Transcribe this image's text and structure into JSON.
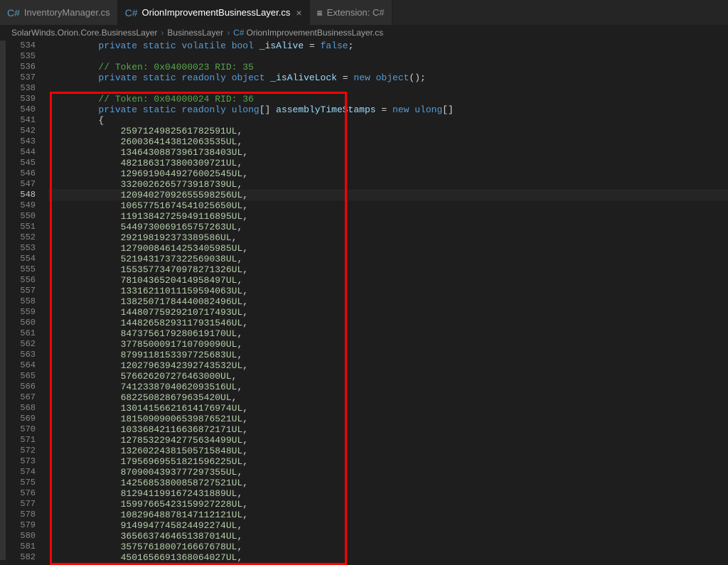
{
  "tabs": [
    {
      "label": "InventoryManager.cs",
      "iconGlyph": "C#",
      "active": false
    },
    {
      "label": "OrionImprovementBusinessLayer.cs",
      "iconGlyph": "C#",
      "active": true
    },
    {
      "label": "Extension: C#",
      "iconGlyph": "≡",
      "active": false,
      "ext": true
    }
  ],
  "breadcrumb": {
    "items": [
      "SolarWinds.Orion.Core.BusinessLayer",
      "BusinessLayer",
      "OrionImprovementBusinessLayer.cs"
    ]
  },
  "editor": {
    "firstLine": 534,
    "lastLine": 582,
    "currentLine": 548,
    "highlightStart": 539,
    "highlightEnd": 582,
    "indentUnit": "    ",
    "lines": {
      "534": {
        "indent": 2,
        "tokens": [
          [
            "kw",
            "private"
          ],
          [
            "sp",
            " "
          ],
          [
            "kw",
            "static"
          ],
          [
            "sp",
            " "
          ],
          [
            "kw",
            "volatile"
          ],
          [
            "sp",
            " "
          ],
          [
            "type",
            "bool"
          ],
          [
            "sp",
            " "
          ],
          [
            "ident",
            "_isAlive"
          ],
          [
            "sp",
            " "
          ],
          [
            "op",
            "="
          ],
          [
            "sp",
            " "
          ],
          [
            "kw",
            "false"
          ],
          [
            "punc",
            ";"
          ]
        ]
      },
      "535": {
        "indent": 0,
        "tokens": []
      },
      "536": {
        "indent": 2,
        "tokens": [
          [
            "comment",
            "// Token: 0x04000023 RID: 35"
          ]
        ]
      },
      "537": {
        "indent": 2,
        "tokens": [
          [
            "kw",
            "private"
          ],
          [
            "sp",
            " "
          ],
          [
            "kw",
            "static"
          ],
          [
            "sp",
            " "
          ],
          [
            "kw",
            "readonly"
          ],
          [
            "sp",
            " "
          ],
          [
            "type",
            "object"
          ],
          [
            "sp",
            " "
          ],
          [
            "ident",
            "_isAliveLock"
          ],
          [
            "sp",
            " "
          ],
          [
            "op",
            "="
          ],
          [
            "sp",
            " "
          ],
          [
            "kw",
            "new"
          ],
          [
            "sp",
            " "
          ],
          [
            "type",
            "object"
          ],
          [
            "punc",
            "();"
          ]
        ]
      },
      "538": {
        "indent": 0,
        "tokens": []
      },
      "539": {
        "indent": 2,
        "tokens": [
          [
            "comment",
            "// Token: 0x04000024 RID: 36"
          ]
        ]
      },
      "540": {
        "indent": 2,
        "tokens": [
          [
            "kw",
            "private"
          ],
          [
            "sp",
            " "
          ],
          [
            "kw",
            "static"
          ],
          [
            "sp",
            " "
          ],
          [
            "kw",
            "readonly"
          ],
          [
            "sp",
            " "
          ],
          [
            "type",
            "ulong"
          ],
          [
            "punc",
            "[]"
          ],
          [
            "sp",
            " "
          ],
          [
            "ident",
            "assemblyTimeStamps"
          ],
          [
            "sp",
            " "
          ],
          [
            "op",
            "="
          ],
          [
            "sp",
            " "
          ],
          [
            "kw",
            "new"
          ],
          [
            "sp",
            " "
          ],
          [
            "type",
            "ulong"
          ],
          [
            "punc",
            "[]"
          ]
        ]
      },
      "541": {
        "indent": 2,
        "tokens": [
          [
            "punc",
            "{"
          ]
        ]
      },
      "542": {
        "indent": 3,
        "tokens": [
          [
            "num",
            "2597124982561782591UL"
          ],
          [
            "punc",
            ","
          ]
        ]
      },
      "543": {
        "indent": 3,
        "tokens": [
          [
            "num",
            "2600364143812063535UL"
          ],
          [
            "punc",
            ","
          ]
        ]
      },
      "544": {
        "indent": 3,
        "tokens": [
          [
            "num",
            "13464308873961738403UL"
          ],
          [
            "punc",
            ","
          ]
        ]
      },
      "545": {
        "indent": 3,
        "tokens": [
          [
            "num",
            "4821863173800309721UL"
          ],
          [
            "punc",
            ","
          ]
        ]
      },
      "546": {
        "indent": 3,
        "tokens": [
          [
            "num",
            "12969190449276002545UL"
          ],
          [
            "punc",
            ","
          ]
        ]
      },
      "547": {
        "indent": 3,
        "tokens": [
          [
            "num",
            "3320026265773918739UL"
          ],
          [
            "punc",
            ","
          ]
        ]
      },
      "548": {
        "indent": 3,
        "tokens": [
          [
            "num",
            "12094027092655598256UL"
          ],
          [
            "punc",
            ","
          ]
        ]
      },
      "549": {
        "indent": 3,
        "tokens": [
          [
            "num",
            "10657751674541025650UL"
          ],
          [
            "punc",
            ","
          ]
        ]
      },
      "550": {
        "indent": 3,
        "tokens": [
          [
            "num",
            "11913842725949116895UL"
          ],
          [
            "punc",
            ","
          ]
        ]
      },
      "551": {
        "indent": 3,
        "tokens": [
          [
            "num",
            "5449730069165757263UL"
          ],
          [
            "punc",
            ","
          ]
        ]
      },
      "552": {
        "indent": 3,
        "tokens": [
          [
            "num",
            "292198192373389586UL"
          ],
          [
            "punc",
            ","
          ]
        ]
      },
      "553": {
        "indent": 3,
        "tokens": [
          [
            "num",
            "12790084614253405985UL"
          ],
          [
            "punc",
            ","
          ]
        ]
      },
      "554": {
        "indent": 3,
        "tokens": [
          [
            "num",
            "5219431737322569038UL"
          ],
          [
            "punc",
            ","
          ]
        ]
      },
      "555": {
        "indent": 3,
        "tokens": [
          [
            "num",
            "15535773470978271326UL"
          ],
          [
            "punc",
            ","
          ]
        ]
      },
      "556": {
        "indent": 3,
        "tokens": [
          [
            "num",
            "7810436520414958497UL"
          ],
          [
            "punc",
            ","
          ]
        ]
      },
      "557": {
        "indent": 3,
        "tokens": [
          [
            "num",
            "13316211011159594063UL"
          ],
          [
            "punc",
            ","
          ]
        ]
      },
      "558": {
        "indent": 3,
        "tokens": [
          [
            "num",
            "13825071784440082496UL"
          ],
          [
            "punc",
            ","
          ]
        ]
      },
      "559": {
        "indent": 3,
        "tokens": [
          [
            "num",
            "14480775929210717493UL"
          ],
          [
            "punc",
            ","
          ]
        ]
      },
      "560": {
        "indent": 3,
        "tokens": [
          [
            "num",
            "14482658293117931546UL"
          ],
          [
            "punc",
            ","
          ]
        ]
      },
      "561": {
        "indent": 3,
        "tokens": [
          [
            "num",
            "8473756179280619170UL"
          ],
          [
            "punc",
            ","
          ]
        ]
      },
      "562": {
        "indent": 3,
        "tokens": [
          [
            "num",
            "3778500091710709090UL"
          ],
          [
            "punc",
            ","
          ]
        ]
      },
      "563": {
        "indent": 3,
        "tokens": [
          [
            "num",
            "8799118153397725683UL"
          ],
          [
            "punc",
            ","
          ]
        ]
      },
      "564": {
        "indent": 3,
        "tokens": [
          [
            "num",
            "12027963942392743532UL"
          ],
          [
            "punc",
            ","
          ]
        ]
      },
      "565": {
        "indent": 3,
        "tokens": [
          [
            "num",
            "576626207276463000UL"
          ],
          [
            "punc",
            ","
          ]
        ]
      },
      "566": {
        "indent": 3,
        "tokens": [
          [
            "num",
            "7412338704062093516UL"
          ],
          [
            "punc",
            ","
          ]
        ]
      },
      "567": {
        "indent": 3,
        "tokens": [
          [
            "num",
            "682250828679635420UL"
          ],
          [
            "punc",
            ","
          ]
        ]
      },
      "568": {
        "indent": 3,
        "tokens": [
          [
            "num",
            "13014156621614176974UL"
          ],
          [
            "punc",
            ","
          ]
        ]
      },
      "569": {
        "indent": 3,
        "tokens": [
          [
            "num",
            "18150909006539876521UL"
          ],
          [
            "punc",
            ","
          ]
        ]
      },
      "570": {
        "indent": 3,
        "tokens": [
          [
            "num",
            "10336842116636872171UL"
          ],
          [
            "punc",
            ","
          ]
        ]
      },
      "571": {
        "indent": 3,
        "tokens": [
          [
            "num",
            "12785322942775634499UL"
          ],
          [
            "punc",
            ","
          ]
        ]
      },
      "572": {
        "indent": 3,
        "tokens": [
          [
            "num",
            "13260224381505715848UL"
          ],
          [
            "punc",
            ","
          ]
        ]
      },
      "573": {
        "indent": 3,
        "tokens": [
          [
            "num",
            "17956969551821596225UL"
          ],
          [
            "punc",
            ","
          ]
        ]
      },
      "574": {
        "indent": 3,
        "tokens": [
          [
            "num",
            "8709004393777297355UL"
          ],
          [
            "punc",
            ","
          ]
        ]
      },
      "575": {
        "indent": 3,
        "tokens": [
          [
            "num",
            "14256853800858727521UL"
          ],
          [
            "punc",
            ","
          ]
        ]
      },
      "576": {
        "indent": 3,
        "tokens": [
          [
            "num",
            "8129411991672431889UL"
          ],
          [
            "punc",
            ","
          ]
        ]
      },
      "577": {
        "indent": 3,
        "tokens": [
          [
            "num",
            "15997665423159927228UL"
          ],
          [
            "punc",
            ","
          ]
        ]
      },
      "578": {
        "indent": 3,
        "tokens": [
          [
            "num",
            "10829648878147112121UL"
          ],
          [
            "punc",
            ","
          ]
        ]
      },
      "579": {
        "indent": 3,
        "tokens": [
          [
            "num",
            "9149947745824492274UL"
          ],
          [
            "punc",
            ","
          ]
        ]
      },
      "580": {
        "indent": 3,
        "tokens": [
          [
            "num",
            "3656637464651387014UL"
          ],
          [
            "punc",
            ","
          ]
        ]
      },
      "581": {
        "indent": 3,
        "tokens": [
          [
            "num",
            "3575761800716667678UL"
          ],
          [
            "punc",
            ","
          ]
        ]
      },
      "582": {
        "indent": 3,
        "tokens": [
          [
            "num",
            "4501656691368064027UL"
          ],
          [
            "punc",
            ","
          ]
        ]
      }
    }
  }
}
